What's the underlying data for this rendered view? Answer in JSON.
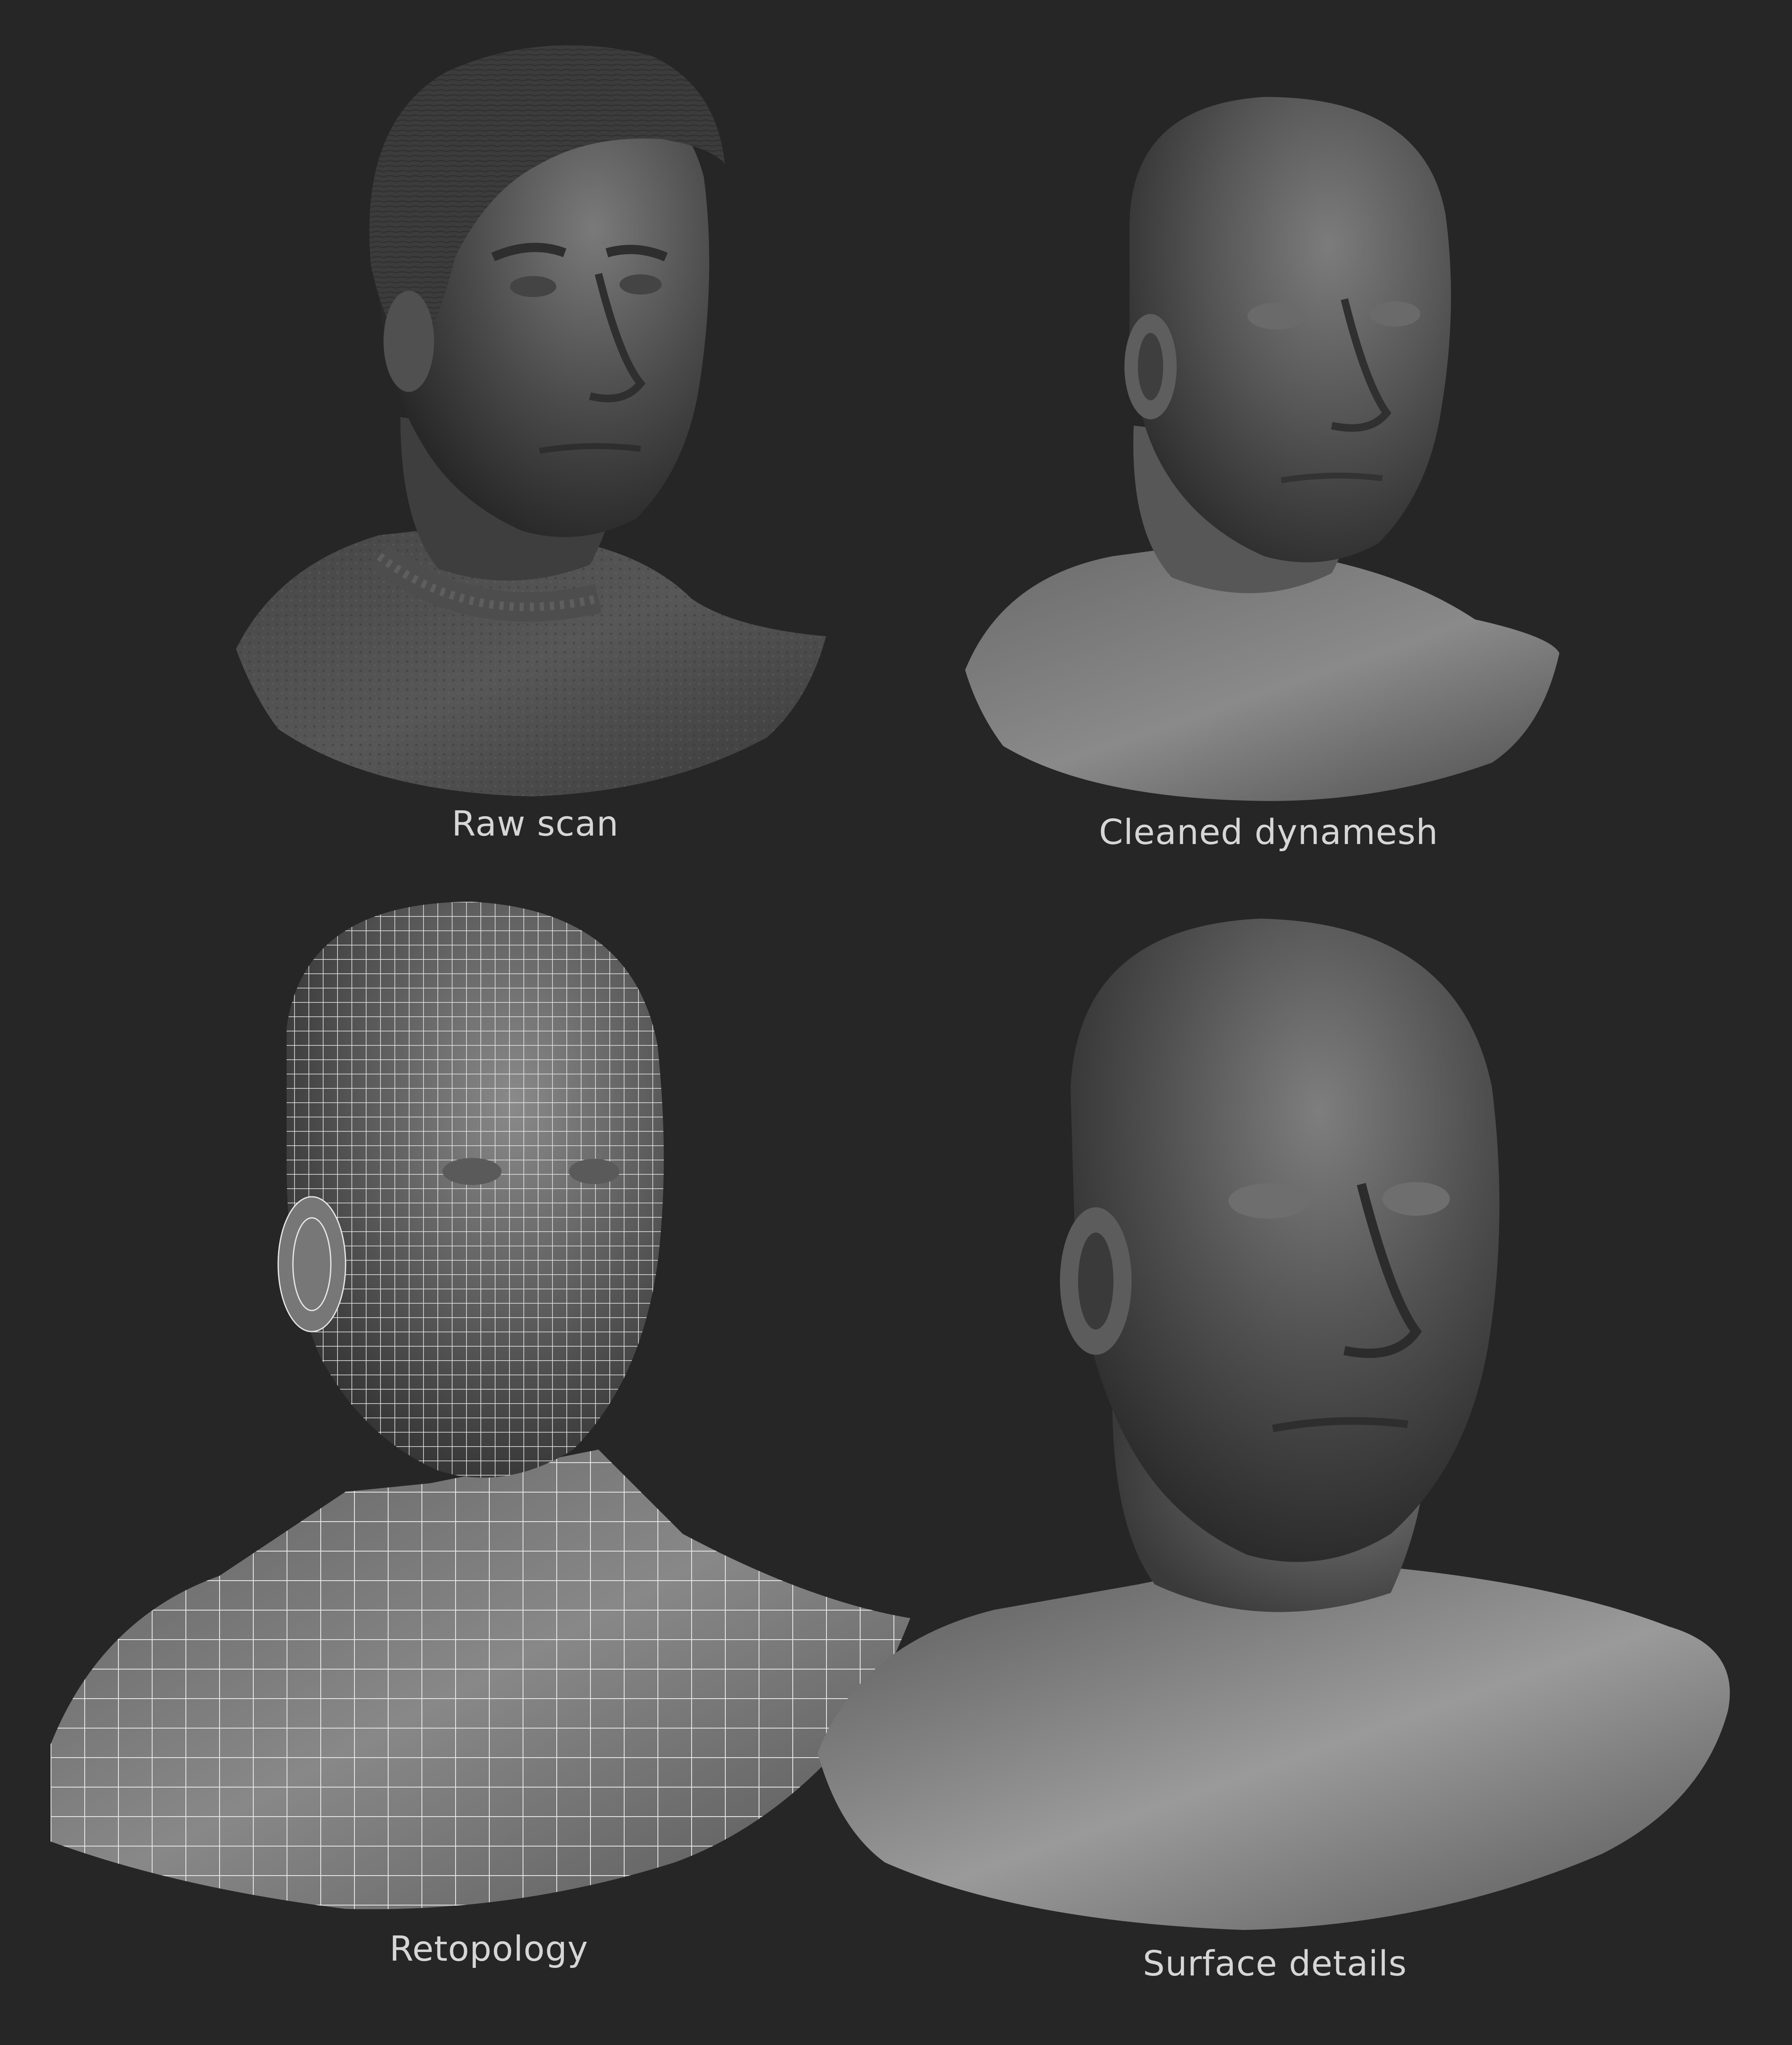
{
  "panels": [
    {
      "id": "raw",
      "caption": "Raw scan"
    },
    {
      "id": "dyna",
      "caption": "Cleaned dynamesh"
    },
    {
      "id": "retopo",
      "caption": "Retopology"
    },
    {
      "id": "surface",
      "caption": "Surface details"
    }
  ],
  "colors": {
    "background": "#262626",
    "caption": "#d6d6d6",
    "wireframe": "#e6e6e6"
  }
}
